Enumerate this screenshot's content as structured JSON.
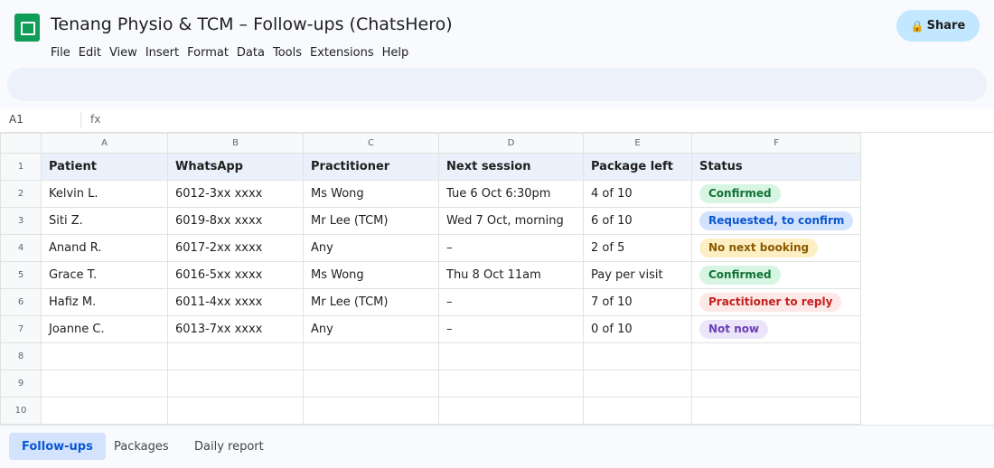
{
  "app": {
    "title": "Tenang Physio & TCM – Follow-ups (ChatsHero)",
    "logo_icon": "google-sheets-logo-icon",
    "share_label": "Share",
    "share_icon": "lock-icon"
  },
  "menu": [
    "File",
    "Edit",
    "View",
    "Insert",
    "Format",
    "Data",
    "Tools",
    "Extensions",
    "Help"
  ],
  "formula_bar": {
    "cell_ref": "A1",
    "fx_label": "fx"
  },
  "grid": {
    "column_letters": [
      "A",
      "B",
      "C",
      "D",
      "E",
      "F"
    ],
    "row_numbers": [
      "1",
      "2",
      "3",
      "4",
      "5",
      "6",
      "7",
      "8",
      "9",
      "10"
    ],
    "headers": [
      "Patient",
      "WhatsApp",
      "Practitioner",
      "Next session",
      "Package left",
      "Status"
    ],
    "rows": [
      {
        "patient": "Kelvin L.",
        "whatsapp": "6012-3xx xxxx",
        "practitioner": "Ms Wong",
        "next_session": "Tue 6 Oct 6:30pm",
        "package_left": "4 of 10",
        "status": "Confirmed",
        "status_kind": "confirmed"
      },
      {
        "patient": "Siti Z.",
        "whatsapp": "6019-8xx xxxx",
        "practitioner": "Mr Lee (TCM)",
        "next_session": "Wed 7 Oct, morning",
        "package_left": "6 of 10",
        "status": "Requested, to confirm",
        "status_kind": "requested"
      },
      {
        "patient": "Anand R.",
        "whatsapp": "6017-2xx xxxx",
        "practitioner": "Any",
        "next_session": "–",
        "package_left": "2 of 5",
        "status": "No next booking",
        "status_kind": "none"
      },
      {
        "patient": "Grace T.",
        "whatsapp": "6016-5xx xxxx",
        "practitioner": "Ms Wong",
        "next_session": "Thu 8 Oct 11am",
        "package_left": "Pay per visit",
        "status": "Confirmed",
        "status_kind": "confirmed"
      },
      {
        "patient": "Hafiz M.",
        "whatsapp": "6011-4xx xxxx",
        "practitioner": "Mr Lee (TCM)",
        "next_session": "–",
        "package_left": "7 of 10",
        "status": "Practitioner to reply",
        "status_kind": "reply"
      },
      {
        "patient": "Joanne C.",
        "whatsapp": "6013-7xx xxxx",
        "practitioner": "Any",
        "next_session": "–",
        "package_left": "0 of 10",
        "status": "Not now",
        "status_kind": "notnow"
      }
    ]
  },
  "status_colors": {
    "confirmed": {
      "bg": "#d6f5e3",
      "fg": "#137333"
    },
    "requested": {
      "bg": "#d3e3fd",
      "fg": "#0b57d0"
    },
    "none": {
      "bg": "#fdefc3",
      "fg": "#8a5a00"
    },
    "reply": {
      "bg": "#fce8e6",
      "fg": "#c5221f"
    },
    "notnow": {
      "bg": "#ece5fa",
      "fg": "#6a3fb5"
    }
  },
  "tabs": [
    {
      "label": "Follow-ups",
      "active": true
    },
    {
      "label": "Packages",
      "active": false
    },
    {
      "label": "Daily report",
      "active": false
    }
  ]
}
